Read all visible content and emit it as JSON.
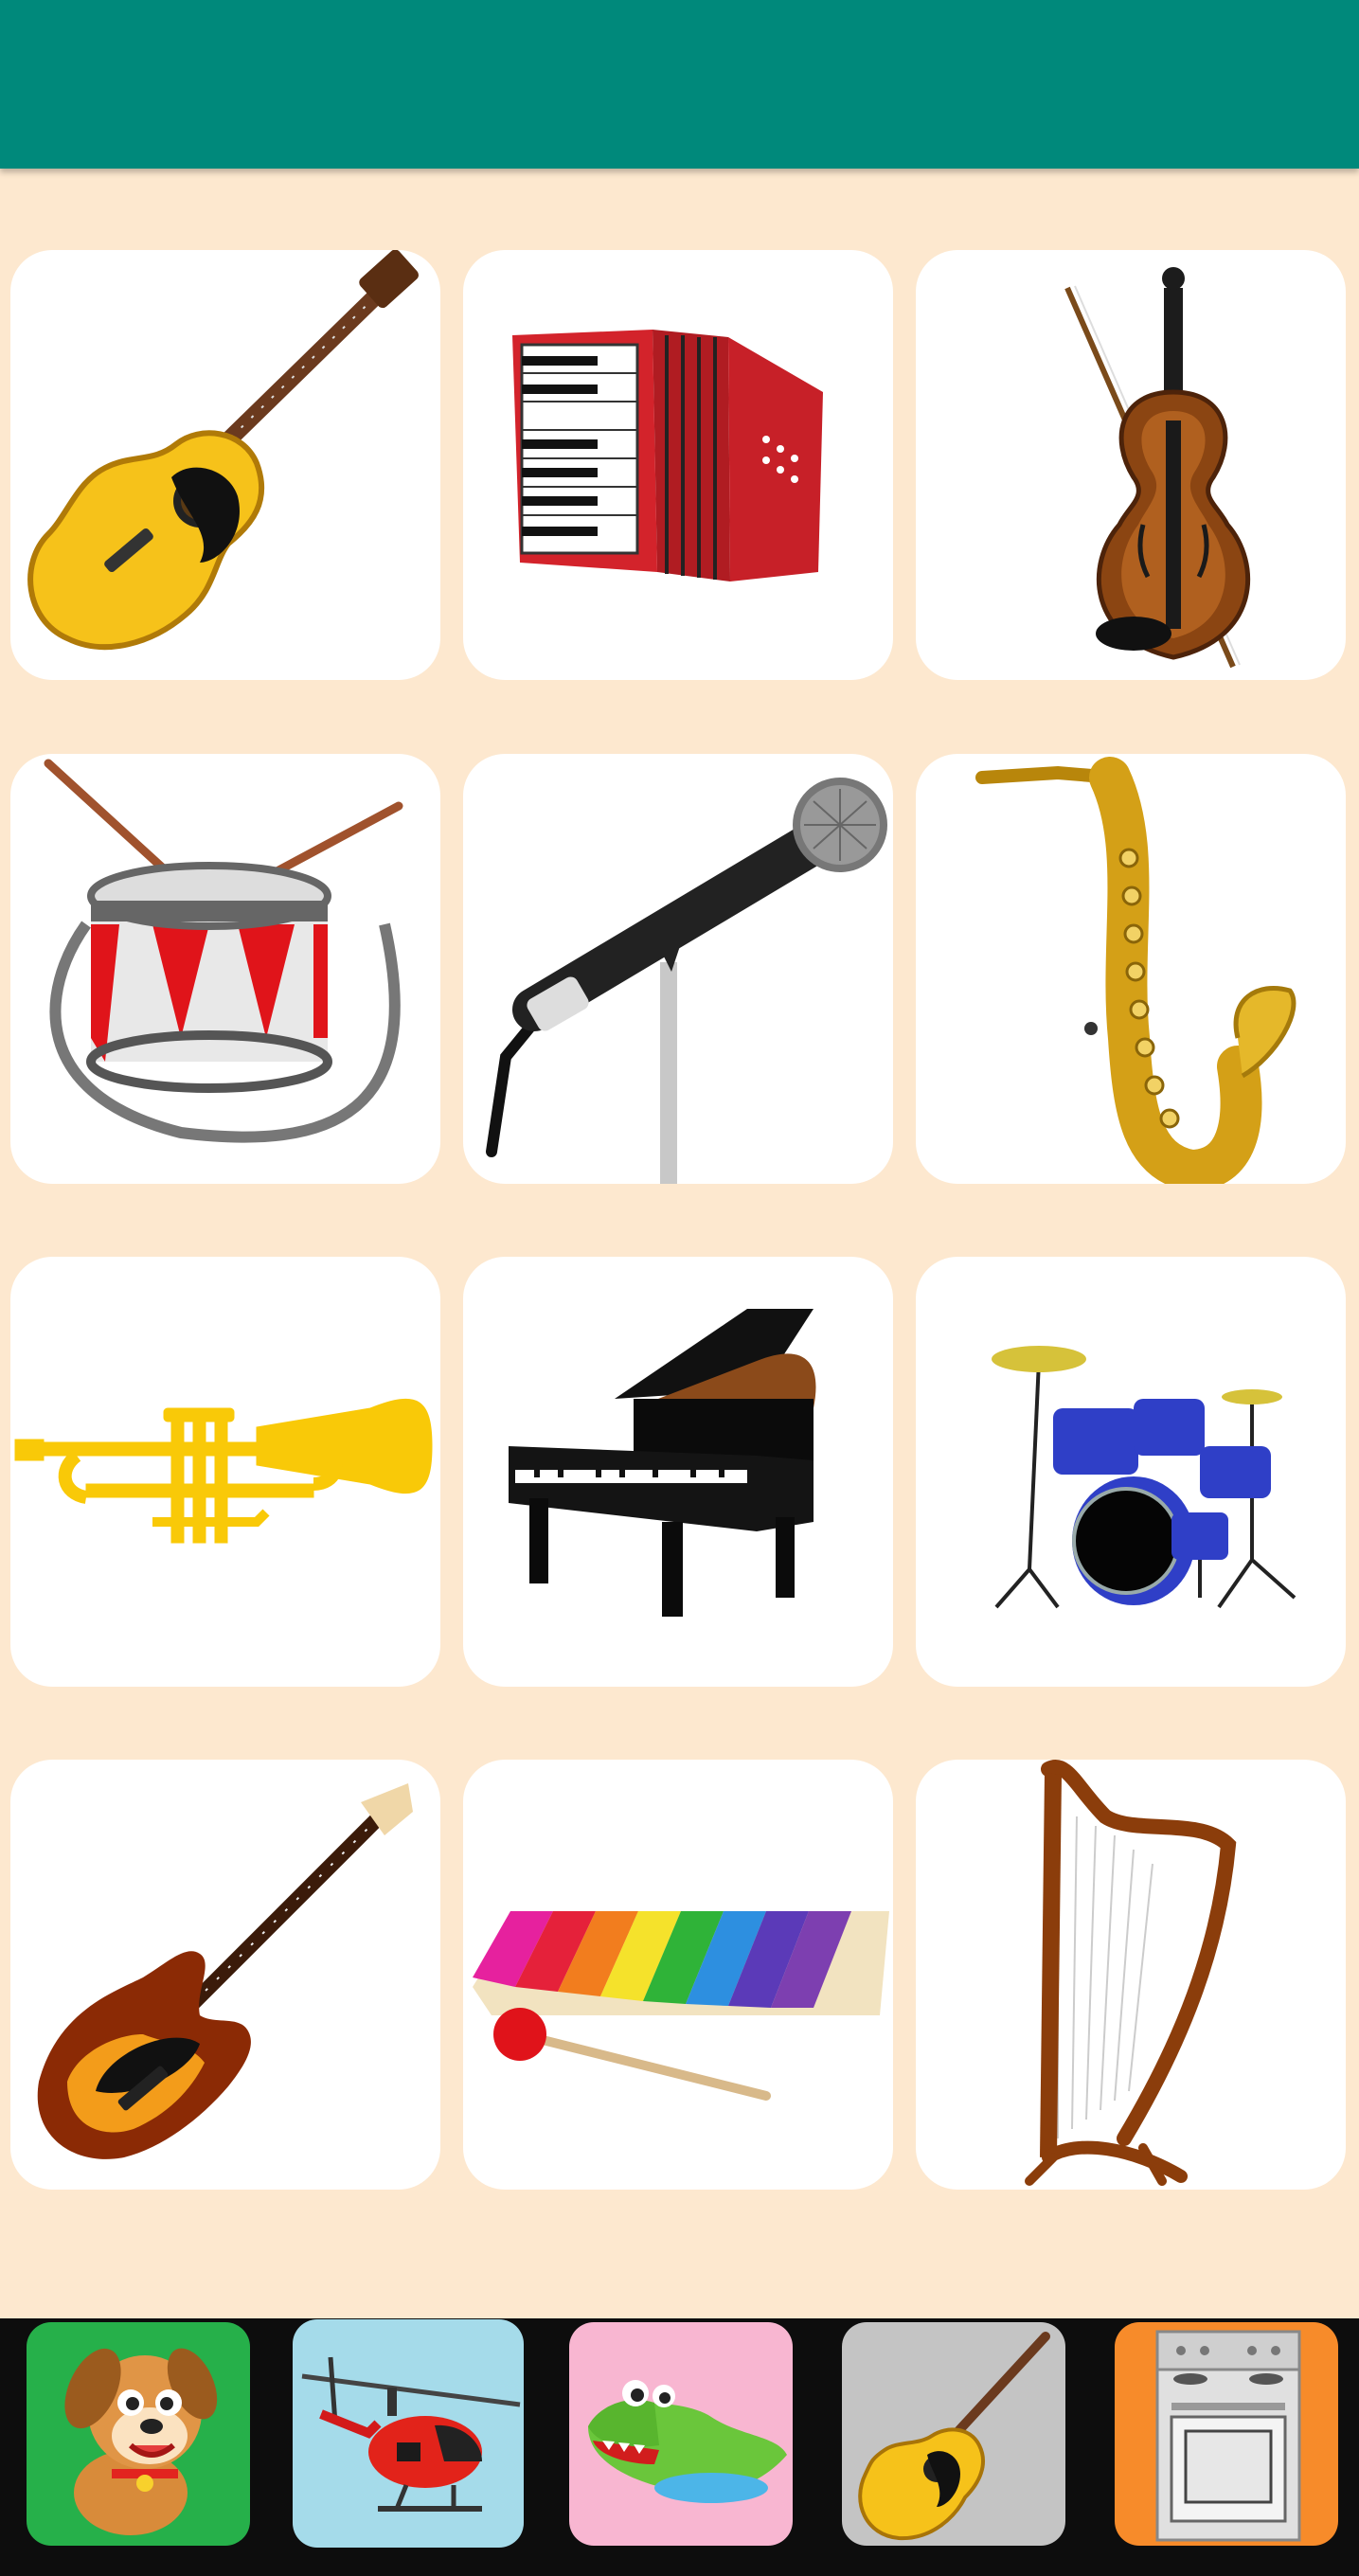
{
  "app": {
    "top_bar_color": "#00897b",
    "background_color": "#fde8cf"
  },
  "instruments": [
    {
      "name": "acoustic-guitar",
      "icon": "acoustic-guitar-icon"
    },
    {
      "name": "accordion",
      "icon": "accordion-icon"
    },
    {
      "name": "violin",
      "icon": "violin-icon"
    },
    {
      "name": "drum",
      "icon": "drum-icon"
    },
    {
      "name": "microphone",
      "icon": "microphone-icon"
    },
    {
      "name": "saxophone",
      "icon": "saxophone-icon"
    },
    {
      "name": "trumpet",
      "icon": "trumpet-icon"
    },
    {
      "name": "grand-piano",
      "icon": "grand-piano-icon"
    },
    {
      "name": "drum-kit",
      "icon": "drum-kit-icon"
    },
    {
      "name": "electric-bass-guitar",
      "icon": "electric-guitar-icon"
    },
    {
      "name": "xylophone",
      "icon": "xylophone-icon"
    },
    {
      "name": "harp",
      "icon": "harp-icon"
    }
  ],
  "categories": [
    {
      "name": "animals",
      "icon": "puppy-icon",
      "color": "#26b04a"
    },
    {
      "name": "vehicles",
      "icon": "helicopter-icon",
      "color": "#a5dbea"
    },
    {
      "name": "wild-animals",
      "icon": "crocodile-icon",
      "color": "#f8b6d1"
    },
    {
      "name": "instruments",
      "icon": "guitar-icon",
      "color": "#c4c4c4",
      "selected": true
    },
    {
      "name": "household",
      "icon": "stove-icon",
      "color": "#f78b2a"
    }
  ]
}
